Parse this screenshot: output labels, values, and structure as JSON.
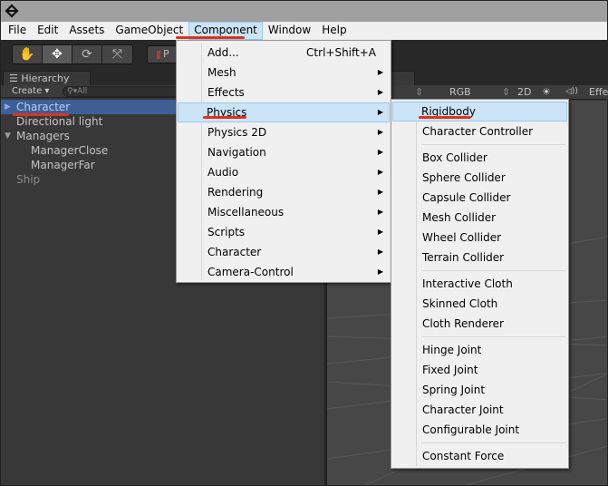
{
  "menubar": {
    "items": [
      "File",
      "Edit",
      "Assets",
      "GameObject",
      "Component",
      "Window",
      "Help"
    ],
    "open_item": "Component"
  },
  "toolbar": {
    "tools": [
      {
        "name": "hand-tool",
        "glyph": "✋"
      },
      {
        "name": "move-tool",
        "glyph": "✥"
      },
      {
        "name": "rotate-tool",
        "glyph": "⟳"
      },
      {
        "name": "scale-tool",
        "glyph": "⤧"
      }
    ],
    "pivot_label": "P"
  },
  "hierarchy": {
    "tab_label": "Hierarchy",
    "create_label": "Create ▾",
    "search_placeholder": "All",
    "rows": [
      {
        "label": "Character",
        "depth": 0,
        "arrow": "▶",
        "selected": true
      },
      {
        "label": "Directional light",
        "depth": 0,
        "arrow": "",
        "selected": false
      },
      {
        "label": "Managers",
        "depth": 0,
        "arrow": "▼",
        "selected": false
      },
      {
        "label": "ManagerClose",
        "depth": 1,
        "arrow": "",
        "selected": false
      },
      {
        "label": "ManagerFar",
        "depth": 1,
        "arrow": "",
        "selected": false
      },
      {
        "label": "Ship",
        "depth": 0,
        "arrow": "",
        "selected": false,
        "dim": true
      }
    ]
  },
  "scene_toolbar": {
    "shading_arrow": "⇕",
    "rgb_label": "RGB",
    "rgb_arrow": "⇕",
    "mode_2d": "2D",
    "light_icon": "☀",
    "audio_icon": "◁))",
    "effects_label": "Effe"
  },
  "component_menu": {
    "items": [
      {
        "label": "Add...",
        "shortcut": "Ctrl+Shift+A",
        "submenu": false
      },
      {
        "label": "Mesh",
        "submenu": true
      },
      {
        "label": "Effects",
        "submenu": true
      },
      {
        "label": "Physics",
        "submenu": true,
        "highlighted": true
      },
      {
        "label": "Physics 2D",
        "submenu": true
      },
      {
        "label": "Navigation",
        "submenu": true
      },
      {
        "label": "Audio",
        "submenu": true
      },
      {
        "label": "Rendering",
        "submenu": true
      },
      {
        "label": "Miscellaneous",
        "submenu": true
      },
      {
        "label": "Scripts",
        "submenu": true
      },
      {
        "label": "Character",
        "submenu": true
      },
      {
        "label": "Camera-Control",
        "submenu": true
      }
    ],
    "submenu_arrow": "▶"
  },
  "physics_menu": {
    "groups": [
      [
        "Rigidbody",
        "Character Controller"
      ],
      [
        "Box Collider",
        "Sphere Collider",
        "Capsule Collider",
        "Mesh Collider",
        "Wheel Collider",
        "Terrain Collider"
      ],
      [
        "Interactive Cloth",
        "Skinned Cloth",
        "Cloth Renderer"
      ],
      [
        "Hinge Joint",
        "Fixed Joint",
        "Spring Joint",
        "Character Joint",
        "Configurable Joint"
      ],
      [
        "Constant Force"
      ]
    ],
    "highlighted": "Rigidbody"
  },
  "colors": {
    "annotation_red": "#e0321c",
    "selection_blue": "#3e5f96",
    "menu_highlight": "#cce4f7"
  }
}
